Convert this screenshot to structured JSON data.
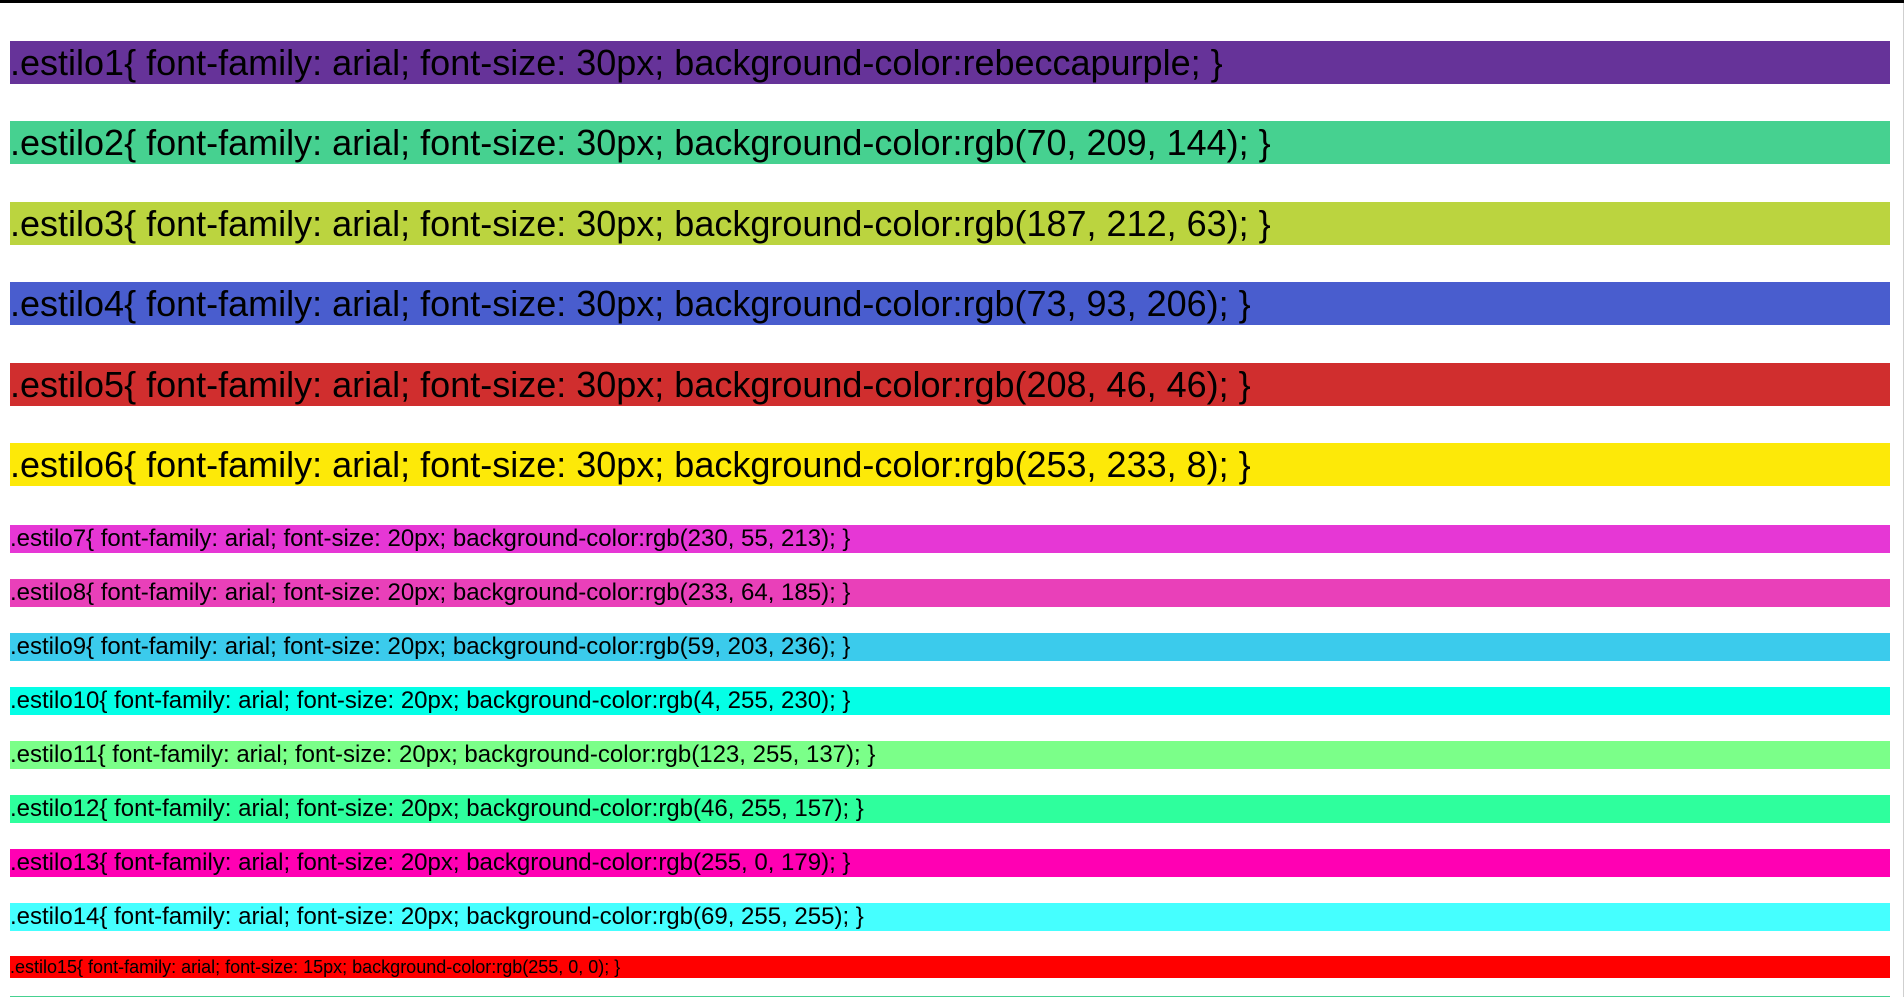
{
  "rules": [
    {
      "text": ".estilo1{ font-family: arial; font-size: 30px; background-color:rebeccapurple; }",
      "color": "#663399",
      "size": "big"
    },
    {
      "text": ".estilo2{ font-family: arial; font-size: 30px; background-color:rgb(70, 209, 144); }",
      "color": "#46d190",
      "size": "big"
    },
    {
      "text": ".estilo3{ font-family: arial; font-size: 30px; background-color:rgb(187, 212, 63); }",
      "color": "#bbd43f",
      "size": "big"
    },
    {
      "text": ".estilo4{ font-family: arial; font-size: 30px; background-color:rgb(73, 93, 206); }",
      "color": "#495dce",
      "size": "big"
    },
    {
      "text": ".estilo5{ font-family: arial; font-size: 30px; background-color:rgb(208, 46, 46); }",
      "color": "#d02e2e",
      "size": "big"
    },
    {
      "text": ".estilo6{ font-family: arial; font-size: 30px; background-color:rgb(253, 233, 8); }",
      "color": "#fde908",
      "size": "big"
    },
    {
      "text": ".estilo7{ font-family: arial; font-size: 20px; background-color:rgb(230, 55, 213); }",
      "color": "#e637d5",
      "size": "mid"
    },
    {
      "text": ".estilo8{ font-family: arial; font-size: 20px; background-color:rgb(233, 64, 185); }",
      "color": "#e940b9",
      "size": "mid"
    },
    {
      "text": ".estilo9{ font-family: arial; font-size: 20px; background-color:rgb(59, 203, 236); }",
      "color": "#3bcbec",
      "size": "mid"
    },
    {
      "text": ".estilo10{ font-family: arial; font-size: 20px; background-color:rgb(4, 255, 230); }",
      "color": "#04ffe6",
      "size": "mid"
    },
    {
      "text": ".estilo11{ font-family: arial; font-size: 20px; background-color:rgb(123, 255, 137); }",
      "color": "#7bff89",
      "size": "mid"
    },
    {
      "text": ".estilo12{ font-family: arial; font-size: 20px; background-color:rgb(46, 255, 157); }",
      "color": "#2eff9d",
      "size": "mid"
    },
    {
      "text": ".estilo13{ font-family: arial; font-size: 20px; background-color:rgb(255, 0, 179); }",
      "color": "#ff00b3",
      "size": "mid"
    },
    {
      "text": ".estilo14{ font-family: arial; font-size: 20px; background-color:rgb(69, 255, 255); }",
      "color": "#45ffff",
      "size": "mid"
    },
    {
      "text": ".estilo15{ font-family: arial; font-size: 15px; background-color:rgb(255, 0, 0); }",
      "color": "#ff0000",
      "size": "small"
    }
  ]
}
